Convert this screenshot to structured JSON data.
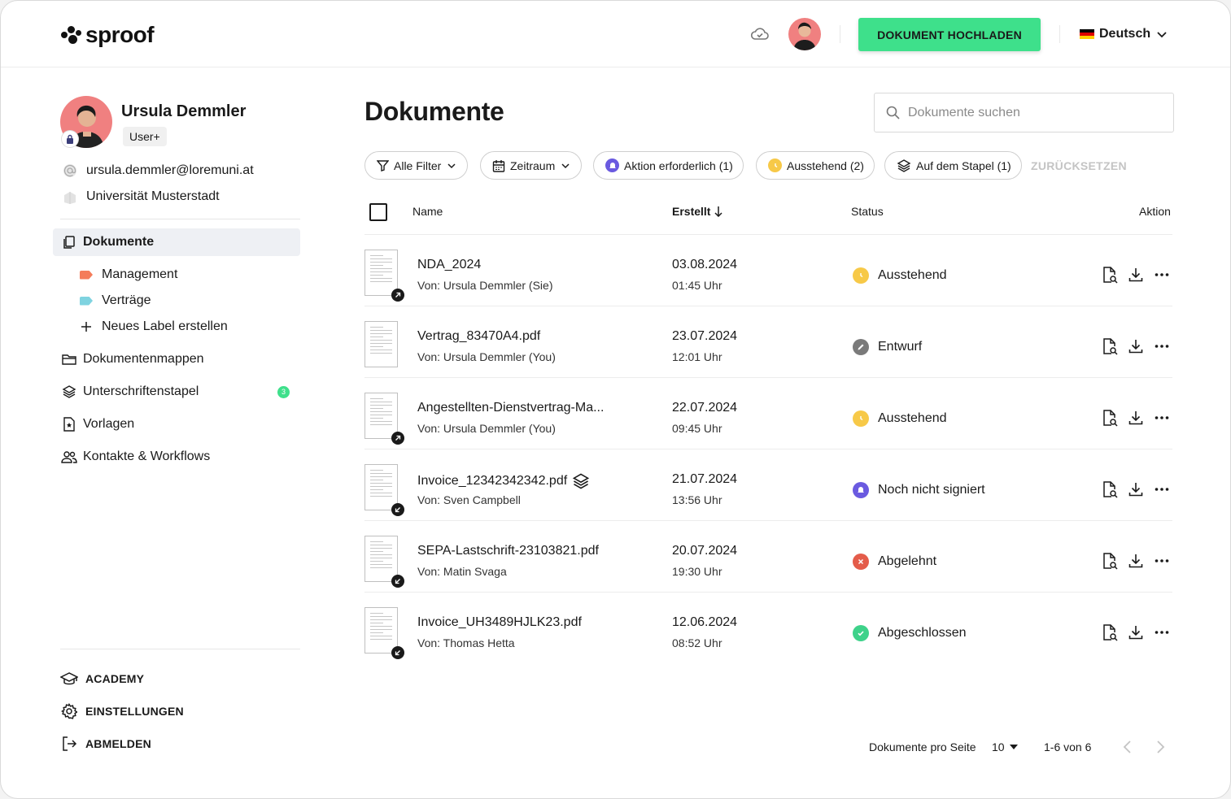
{
  "brand": {
    "logo_text": "sproof"
  },
  "header": {
    "upload_label": "DOKUMENT HOCHLADEN",
    "language": "Deutsch",
    "accent": "#3ee08b"
  },
  "profile": {
    "name": "Ursula Demmler",
    "role": "User+",
    "email": "ursula.demmler@loremuni.at",
    "organization": "Universität Musterstadt"
  },
  "sidebar": {
    "items": [
      {
        "label": "Dokumente",
        "icon": "documents-icon",
        "active": true
      },
      {
        "label": "Dokumentenmappen",
        "icon": "folder-icon"
      },
      {
        "label": "Unterschriftenstapel",
        "icon": "stack-icon",
        "badge": "3"
      },
      {
        "label": "Vorlagen",
        "icon": "template-icon"
      },
      {
        "label": "Kontakte & Workflows",
        "icon": "contacts-icon"
      }
    ],
    "labels": [
      {
        "label": "Management",
        "color": "#f47c5a"
      },
      {
        "label": "Verträge",
        "color": "#7fd3e0"
      }
    ],
    "new_label": "Neues Label erstellen",
    "bottom": [
      {
        "label": "ACADEMY",
        "icon": "graduation-cap-icon"
      },
      {
        "label": "EINSTELLUNGEN",
        "icon": "gear-icon"
      },
      {
        "label": "ABMELDEN",
        "icon": "logout-icon"
      }
    ]
  },
  "main": {
    "title": "Dokumente",
    "search_placeholder": "Dokumente suchen",
    "filters": {
      "all": "Alle Filter",
      "period": "Zeitraum",
      "action_required": "Aktion erforderlich (1)",
      "pending": "Ausstehend (2)",
      "stack": "Auf dem Stapel (1)",
      "reset": "ZURÜCKSETZEN"
    },
    "columns": {
      "name": "Name",
      "created": "Erstellt",
      "status": "Status",
      "action": "Aktion"
    },
    "documents": [
      {
        "name": "NDA_2024",
        "from": "Von: Ursula Demmler (Sie)",
        "date": "03.08.2024",
        "time": "01:45 Uhr",
        "status": "Ausstehend",
        "status_color": "#f7c948",
        "direction": "outgoing",
        "stacked": false
      },
      {
        "name": "Vertrag_83470A4.pdf",
        "from": "Von: Ursula Demmler (You)",
        "date": "23.07.2024",
        "time": "12:01 Uhr",
        "status": "Entwurf",
        "status_color": "#7a7a7a",
        "direction": "none",
        "stacked": false
      },
      {
        "name": "Angestellten-Dienstvertrag-Ma...",
        "from": "Von: Ursula Demmler (You)",
        "date": "22.07.2024",
        "time": "09:45 Uhr",
        "status": "Ausstehend",
        "status_color": "#f7c948",
        "direction": "outgoing",
        "stacked": false
      },
      {
        "name": "Invoice_12342342342.pdf",
        "from": "Von: Sven Campbell",
        "date": "21.07.2024",
        "time": "13:56 Uhr",
        "status": "Noch nicht signiert",
        "status_color": "#6a5ae0",
        "direction": "incoming",
        "stacked": true
      },
      {
        "name": "SEPA-Lastschrift-23103821.pdf",
        "from": "Von: Matin Svaga",
        "date": "20.07.2024",
        "time": "19:30 Uhr",
        "status": "Abgelehnt",
        "status_color": "#e45c4a",
        "direction": "incoming",
        "stacked": false
      },
      {
        "name": "Invoice_UH3489HJLK23.pdf",
        "from": "Von: Thomas Hetta",
        "date": "12.06.2024",
        "time": "08:52 Uhr",
        "status": "Abgeschlossen",
        "status_color": "#3ed28a",
        "direction": "incoming",
        "stacked": false
      }
    ],
    "pagination": {
      "per_page_label": "Dokumente pro Seite",
      "per_page": "10",
      "range": "1-6 von 6"
    }
  }
}
